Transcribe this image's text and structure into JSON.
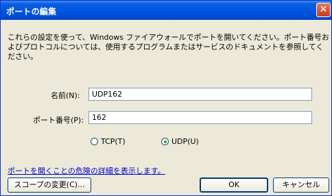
{
  "window": {
    "title": "ポートの編集",
    "close_icon": "close-icon"
  },
  "description": "これらの設定を使って、Windows ファイアウォールでポートを開いてください。ポート番号およびプロトコルについては、使用するプログラムまたはサービスのドキュメントを参照してください。",
  "form": {
    "name_label": "名前(N):",
    "name_value": "UDP162",
    "port_label": "ポート番号(P):",
    "port_value": "162",
    "tcp_label": "TCP(T)",
    "udp_label": "UDP(U)",
    "protocol_selected": "UDP"
  },
  "link": "ポートを開くことの危険の詳細を表示します。",
  "buttons": {
    "scope": "スコープの変更(C)...",
    "ok": "OK",
    "cancel": "キャンセル"
  }
}
